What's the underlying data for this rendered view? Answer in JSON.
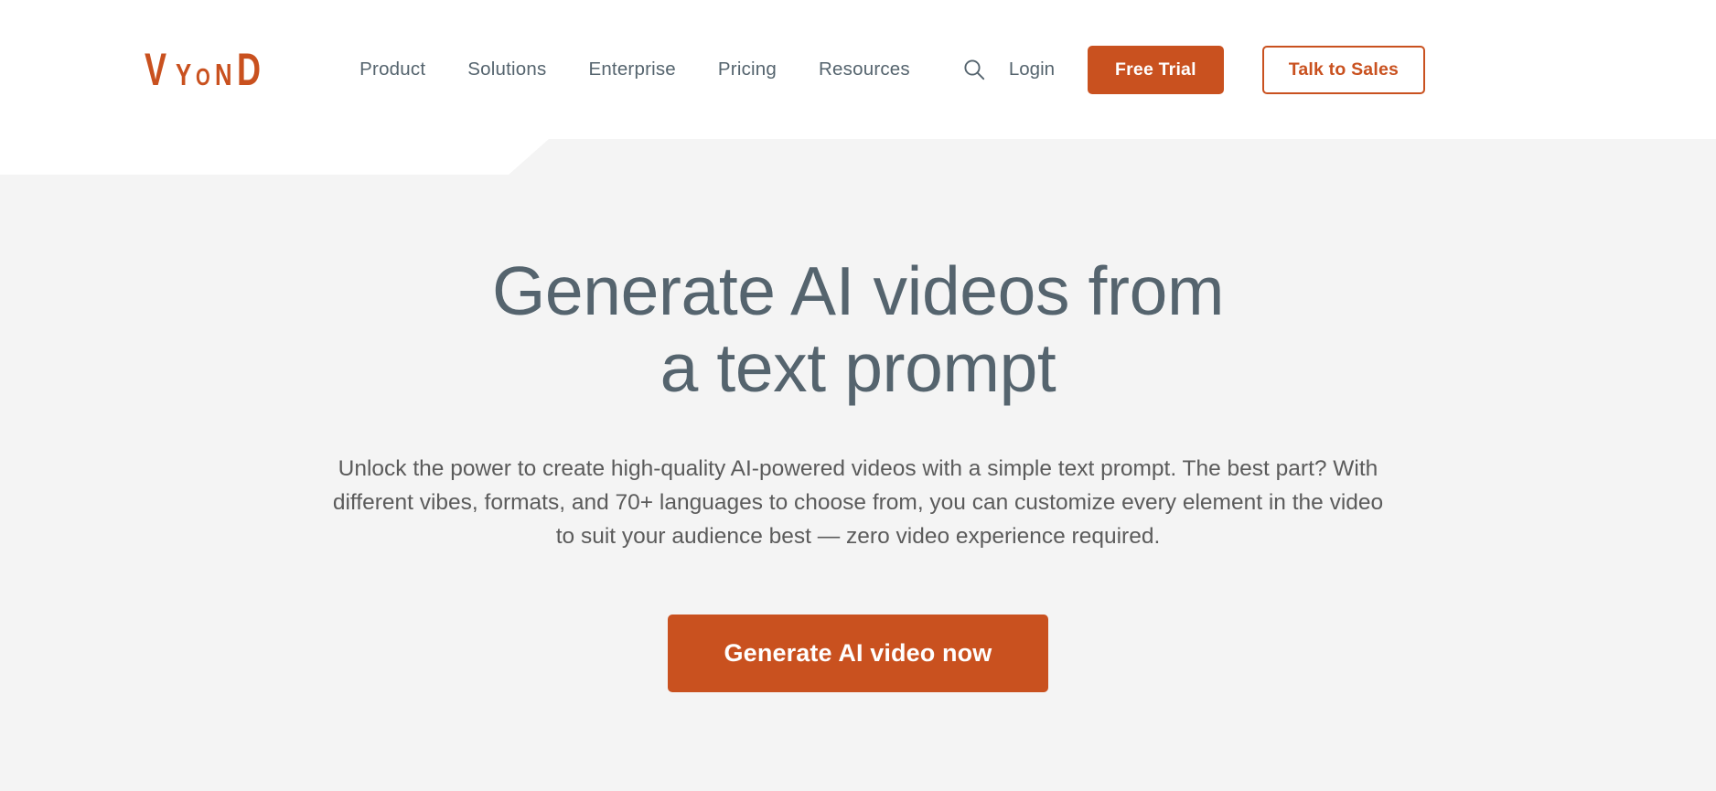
{
  "brand": {
    "accent": "#c9511f",
    "text_slate": "#55646e",
    "page_bg": "#f4f4f4",
    "header_bg": "#ffffff"
  },
  "header": {
    "logo": {
      "name": "vyond-logo",
      "part_v": "V",
      "part_y": "Y",
      "part_o": "O",
      "part_n": "N",
      "part_d": "D",
      "full_text": "VYOND"
    },
    "nav": [
      {
        "label": "Product",
        "name": "nav-link-product"
      },
      {
        "label": "Solutions",
        "name": "nav-link-solutions"
      },
      {
        "label": "Enterprise",
        "name": "nav-link-enterprise"
      },
      {
        "label": "Pricing",
        "name": "nav-link-pricing"
      },
      {
        "label": "Resources",
        "name": "nav-link-resources"
      }
    ],
    "search_icon": "search-icon",
    "login_label": "Login",
    "free_trial_label": "Free Trial",
    "talk_to_sales_label": "Talk to Sales"
  },
  "hero": {
    "title_line1": "Generate AI videos from",
    "title_line2": "a text prompt",
    "subtitle": "Unlock the power to create high-quality AI-powered videos with a simple text prompt. The best part? With different vibes, formats, and 70+ languages to choose from, you can customize every element in the video to suit your audience best — zero video experience required.",
    "cta_label": "Generate AI video now"
  }
}
